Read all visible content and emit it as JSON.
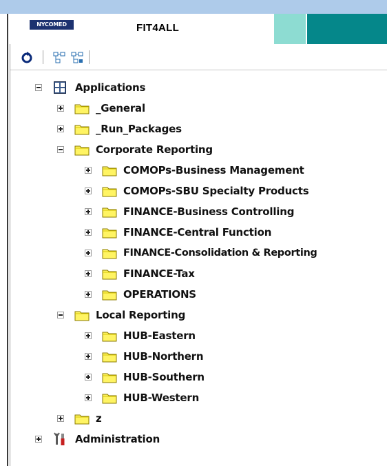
{
  "header": {
    "logo_text": "NYCOMED",
    "app_title": "FIT4ALL"
  },
  "toolbar": {
    "buttons": [
      {
        "icon": "refresh-icon"
      },
      {
        "icon": "tree-expand-icon"
      },
      {
        "icon": "tree-collapse-icon"
      }
    ]
  },
  "tree": {
    "applications": {
      "label": "Applications",
      "state": "expanded",
      "children": {
        "general": {
          "label": "_General",
          "state": "collapsed"
        },
        "run_packages": {
          "label": "_Run_Packages",
          "state": "collapsed"
        },
        "corporate_reporting": {
          "label": "Corporate Reporting",
          "state": "expanded",
          "children": [
            {
              "label": "COMOPs-Business Management",
              "state": "collapsed"
            },
            {
              "label": "COMOPs-SBU Specialty Products",
              "state": "collapsed"
            },
            {
              "label": "FINANCE-Business Controlling",
              "state": "collapsed"
            },
            {
              "label": "FINANCE-Central Function",
              "state": "collapsed"
            },
            {
              "label": "FINANCE-Consolidation & Reporting",
              "state": "collapsed"
            },
            {
              "label": "FINANCE-Tax",
              "state": "collapsed"
            },
            {
              "label": "OPERATIONS",
              "state": "collapsed"
            }
          ]
        },
        "local_reporting": {
          "label": "Local Reporting",
          "state": "expanded",
          "children": [
            {
              "label": "HUB-Eastern",
              "state": "collapsed"
            },
            {
              "label": "HUB-Northern",
              "state": "collapsed"
            },
            {
              "label": "HUB-Southern",
              "state": "collapsed"
            },
            {
              "label": "HUB-Western",
              "state": "collapsed"
            }
          ]
        },
        "z": {
          "label": "z",
          "state": "collapsed"
        }
      }
    },
    "administration": {
      "label": "Administration",
      "state": "collapsed"
    }
  },
  "colors": {
    "folder_fill": "#fff463",
    "folder_stroke": "#8a7a00",
    "header_teal": "#05878a",
    "header_mint": "#8ddcd2",
    "title_bar": "#aecbea"
  }
}
